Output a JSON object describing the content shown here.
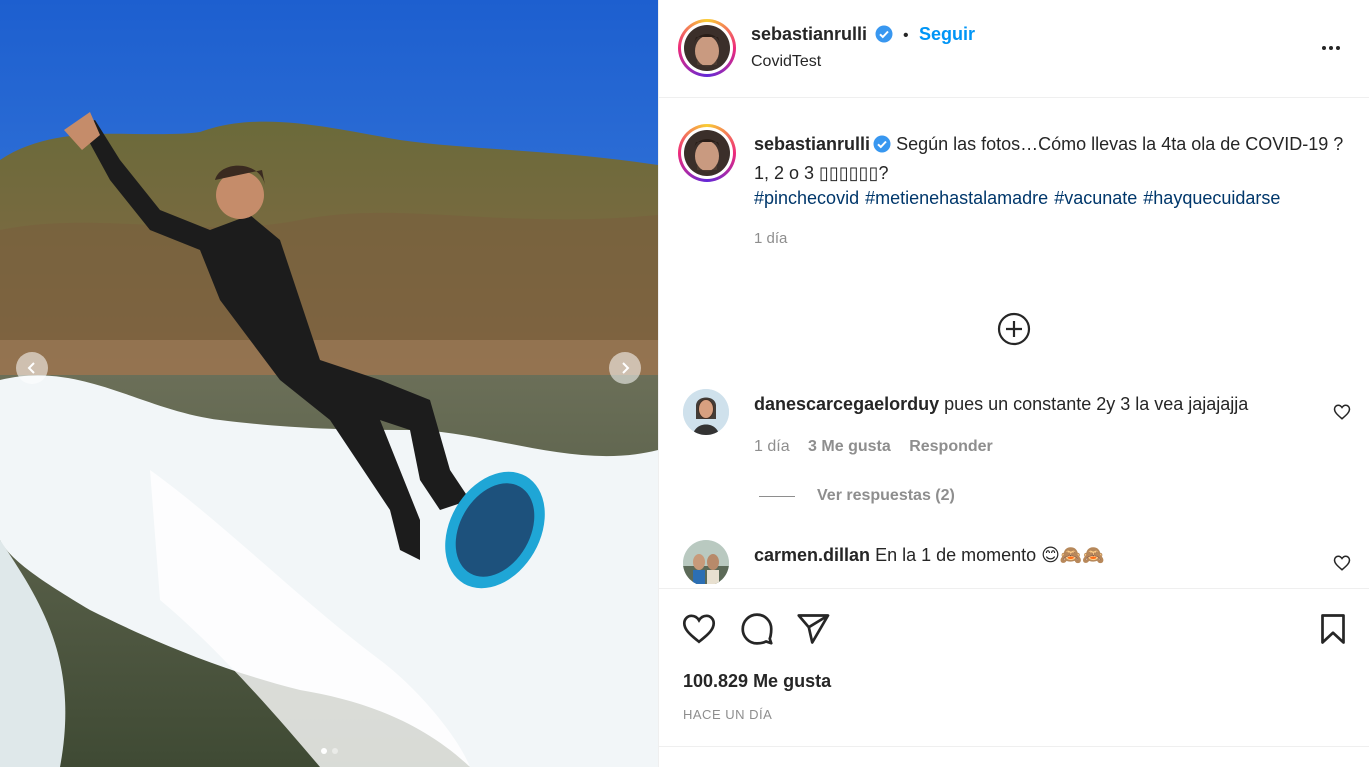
{
  "post": {
    "carousel": {
      "total": 2,
      "active": 1
    }
  },
  "header": {
    "username": "sebastianrulli",
    "follow_label": "Seguir",
    "separator": "•",
    "location": "CovidTest"
  },
  "caption": {
    "username": "sebastianrulli",
    "text_line1": "Según las fotos…Cómo llevas la 4ta ola de COVID-19 ?",
    "text_line2": "1, 2 o 3 ▯▯▯▯▯▯?",
    "hashtags": [
      "#pinchecovid",
      "#metienehastalamadre",
      "#vacunate",
      "#hayquecuidarse"
    ],
    "time": "1 día"
  },
  "comments": [
    {
      "username": "danescarcegaelorduy",
      "text": "pues un constante 2y 3 la vea jajajajja",
      "time": "1 día",
      "likes": "3 Me gusta",
      "reply_label": "Responder",
      "view_replies": "Ver respuestas (2)"
    },
    {
      "username": "carmen.dillan",
      "text": "En la 1 de momento 😊🙈🙈"
    }
  ],
  "actions": {
    "likes": "100.829 Me gusta",
    "time_ago": "HACE UN DÍA"
  },
  "icons": {
    "more": "more-options-icon",
    "load_more": "load-more-comments-icon",
    "like": "heart-icon",
    "comment": "comment-icon",
    "share": "share-icon",
    "save": "bookmark-icon",
    "verified": "verified-badge-icon"
  },
  "colors": {
    "link": "#0095f6",
    "hashtag": "#00376b",
    "muted": "#8e8e8e"
  }
}
